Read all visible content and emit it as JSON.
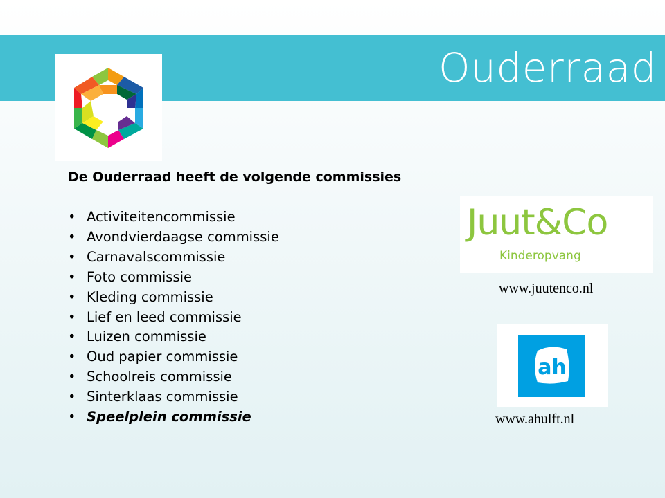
{
  "slide": {
    "title": "Ouderraad",
    "heading": "De Ouderraad heeft de volgende commissies",
    "bullet_symbol": "•",
    "commissions": [
      "Activiteitencommissie",
      "Avondvierdaagse commissie",
      "Carnavalscommissie",
      "Foto commissie",
      "Kleding commissie",
      "Lief en leed commissie",
      "Luizen commissie",
      "Oud papier commissie",
      "Schoolreis commissie",
      "Sinterklaas commissie",
      "Speelplein commissie"
    ],
    "emphasized_commission": "Speelplein commissie"
  },
  "sponsors": {
    "juutenco": {
      "logo_name": "Juut&Co",
      "logo_subtitle": "Kinderopvang",
      "url": "www.juutenco.nl"
    },
    "ah": {
      "logo_text": "ah",
      "url": "www.ahulft.nl"
    }
  },
  "colors": {
    "banner": "#44bfd2",
    "juut_green": "#8dc63f",
    "ah_blue": "#00a0e2"
  },
  "icons": {
    "school_logo": "multicolor-hexagon-logo",
    "ah_logo": "albert-heijn-logo"
  }
}
